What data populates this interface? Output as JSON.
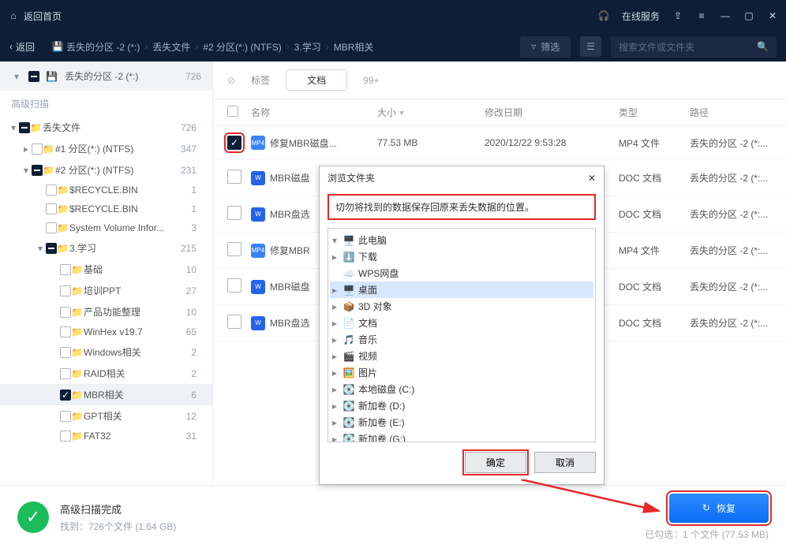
{
  "titlebar": {
    "home": "返回首页",
    "service": "在线服务"
  },
  "toolbar": {
    "back": "返回",
    "crumb": [
      "丢失的分区 -2 (*:)",
      "丢失文件",
      "#2 分区(*:) (NTFS)",
      "3.学习",
      "MBR相关"
    ],
    "filter": "筛选",
    "search_ph": "搜索文件或文件夹"
  },
  "tabs": {
    "tag": "标签",
    "doc": "文档",
    "more": "99+"
  },
  "columns": {
    "name": "名称",
    "size": "大小",
    "date": "修改日期",
    "type": "类型",
    "path": "路径"
  },
  "rows": [
    {
      "checked": true,
      "icon": "mp4",
      "name": "修复MBR磁盘...",
      "size": "77.53 MB",
      "date": "2020/12/22 9:53:28",
      "type": "MP4 文件",
      "path": "丢失的分区 -2 (*:..."
    },
    {
      "checked": false,
      "icon": "doc",
      "name": "MBR磁盘",
      "size": "",
      "date": "",
      "type": "DOC 文档",
      "path": "丢失的分区 -2 (*:..."
    },
    {
      "checked": false,
      "icon": "doc",
      "name": "MBR盘选",
      "size": "",
      "date": "",
      "type": "DOC 文档",
      "path": "丢失的分区 -2 (*:..."
    },
    {
      "checked": false,
      "icon": "mp4",
      "name": "修复MBR",
      "size": "",
      "date": "",
      "type": "MP4 文件",
      "path": "丢失的分区 -2 (*:..."
    },
    {
      "checked": false,
      "icon": "doc",
      "name": "MBR磁盘",
      "size": "",
      "date": "",
      "type": "DOC 文档",
      "path": "丢失的分区 -2 (*:..."
    },
    {
      "checked": false,
      "icon": "doc",
      "name": "MBR盘选",
      "size": "",
      "date": "",
      "type": "DOC 文档",
      "path": "丢失的分区 -2 (*:..."
    }
  ],
  "sidebar": {
    "head": {
      "label": "丢失的分区 -2 (*:)",
      "count": "726"
    },
    "sub": "高级扫描",
    "items": [
      {
        "lv": 0,
        "exp": "▾",
        "chk": "ind",
        "label": "丢失文件",
        "count": "726"
      },
      {
        "lv": 1,
        "exp": "▸",
        "chk": "",
        "label": "#1 分区(*:) (NTFS)",
        "count": "347"
      },
      {
        "lv": 1,
        "exp": "▾",
        "chk": "ind",
        "label": "#2 分区(*:) (NTFS)",
        "count": "231"
      },
      {
        "lv": 2,
        "exp": "",
        "chk": "",
        "label": "$RECYCLE.BIN",
        "count": "1"
      },
      {
        "lv": 2,
        "exp": "",
        "chk": "",
        "label": "$RECYCLE.BIN",
        "count": "1"
      },
      {
        "lv": 2,
        "exp": "",
        "chk": "",
        "label": "System Volume Infor...",
        "count": "3"
      },
      {
        "lv": 2,
        "exp": "▾",
        "chk": "ind",
        "label": "3.学习",
        "count": "215"
      },
      {
        "lv": 3,
        "exp": "",
        "chk": "",
        "label": "基础",
        "count": "10"
      },
      {
        "lv": 3,
        "exp": "",
        "chk": "",
        "label": "培训PPT",
        "count": "27"
      },
      {
        "lv": 3,
        "exp": "",
        "chk": "",
        "label": "产品功能整理",
        "count": "10"
      },
      {
        "lv": 3,
        "exp": "",
        "chk": "",
        "label": "WinHex v19.7",
        "count": "65"
      },
      {
        "lv": 3,
        "exp": "",
        "chk": "",
        "label": "Windows相关",
        "count": "2"
      },
      {
        "lv": 3,
        "exp": "",
        "chk": "",
        "label": "RAID相关",
        "count": "2"
      },
      {
        "lv": 3,
        "exp": "",
        "chk": "on",
        "label": "MBR相关",
        "count": "6",
        "sel": true
      },
      {
        "lv": 3,
        "exp": "",
        "chk": "",
        "label": "GPT相关",
        "count": "12"
      },
      {
        "lv": 3,
        "exp": "",
        "chk": "",
        "label": "FAT32",
        "count": "31"
      }
    ]
  },
  "footer": {
    "title": "高级扫描完成",
    "sub": "找到：726个文件 (1.64 GB)",
    "recover": "恢复",
    "selected": "已勾选：1 个文件 (77.53 MB)"
  },
  "dialog": {
    "title": "浏览文件夹",
    "warn": "切勿将找到的数据保存回原来丢失数据的位置。",
    "ok": "确定",
    "cancel": "取消",
    "tree": [
      {
        "lv": 0,
        "exp": "▾",
        "ic": "pc",
        "label": "此电脑"
      },
      {
        "lv": 1,
        "exp": "▸",
        "ic": "dl",
        "label": "下载"
      },
      {
        "lv": 1,
        "exp": "",
        "ic": "wps",
        "label": "WPS网盘"
      },
      {
        "lv": 1,
        "exp": "▸",
        "ic": "desk",
        "label": "桌面",
        "sel": true
      },
      {
        "lv": 1,
        "exp": "▸",
        "ic": "3d",
        "label": "3D 对象"
      },
      {
        "lv": 1,
        "exp": "▸",
        "ic": "doc",
        "label": "文档"
      },
      {
        "lv": 1,
        "exp": "▸",
        "ic": "mus",
        "label": "音乐"
      },
      {
        "lv": 1,
        "exp": "▸",
        "ic": "vid",
        "label": "视频"
      },
      {
        "lv": 1,
        "exp": "▸",
        "ic": "img",
        "label": "图片"
      },
      {
        "lv": 1,
        "exp": "▸",
        "ic": "drv",
        "label": "本地磁盘 (C:)"
      },
      {
        "lv": 1,
        "exp": "▸",
        "ic": "drv",
        "label": "新加卷 (D:)"
      },
      {
        "lv": 1,
        "exp": "▸",
        "ic": "drv",
        "label": "新加卷 (E:)"
      },
      {
        "lv": 1,
        "exp": "▸",
        "ic": "drv",
        "label": "新加卷 (G:)"
      }
    ]
  }
}
